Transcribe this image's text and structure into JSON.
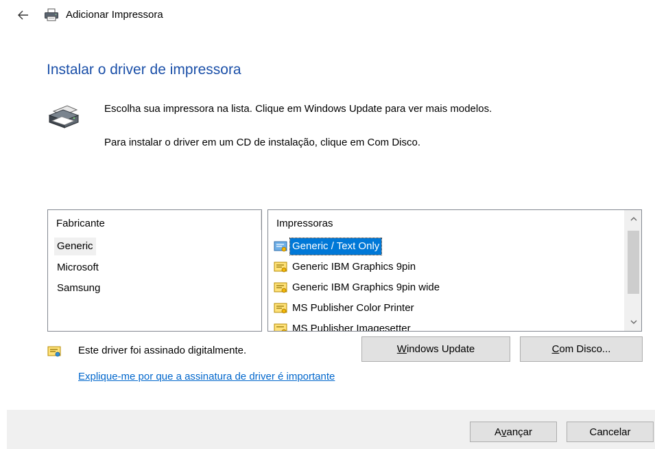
{
  "window": {
    "title": "Adicionar Impressora",
    "back_icon": "arrow-left-icon",
    "title_icon": "printer-icon"
  },
  "heading": "Instalar o driver de impressora",
  "instructions": {
    "line1": "Escolha sua impressora na lista. Clique em Windows Update para ver mais modelos.",
    "line2": "Para instalar o driver em um CD de instalação, clique em Com Disco."
  },
  "manufacturers": {
    "header": "Fabricante",
    "items": [
      "Generic",
      "Microsoft",
      "Samsung"
    ],
    "selected": "Generic"
  },
  "printers": {
    "header": "Impressoras",
    "items": [
      "Generic / Text Only",
      "Generic IBM Graphics 9pin",
      "Generic IBM Graphics 9pin wide",
      "MS Publisher Color Printer",
      "MS Publisher Imagesetter"
    ],
    "selected": "Generic / Text Only",
    "item_icon": "signed-driver-icon"
  },
  "driver_status": {
    "text": "Este driver foi assinado digitalmente.",
    "link": "Explique-me por que a assinatura de driver é importante"
  },
  "buttons": {
    "windows_update": {
      "mnemonic": "W",
      "rest": "indows Update"
    },
    "have_disk": {
      "mnemonic": "C",
      "rest": "om Disco..."
    },
    "next": {
      "before": "A",
      "mnemonic": "v",
      "rest": "ançar"
    },
    "cancel": "Cancelar"
  },
  "colors": {
    "heading": "#1a4fa8",
    "selection": "#0078d7",
    "link": "#0066cc",
    "button_face": "#e1e1e1",
    "footer": "#f0f0f0"
  }
}
